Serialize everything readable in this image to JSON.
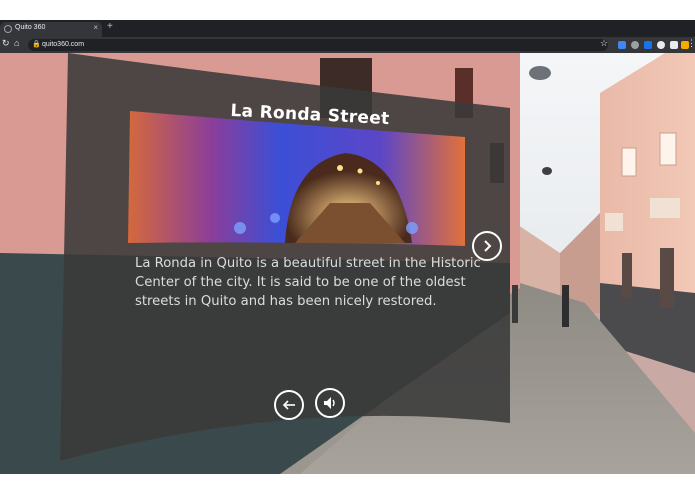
{
  "browser": {
    "tab_title": "Quito 360",
    "tab_close": "×",
    "new_tab": "+",
    "url": "quito360.com",
    "reload_icon": "reload-icon",
    "home_icon": "home-icon",
    "lock_icon": "lock-icon",
    "star_icon": "bookmark-star-icon",
    "menu_icon": "kebab-menu-icon",
    "extensions": [
      {
        "name": "extension-icon-1",
        "color": "#4285f4"
      },
      {
        "name": "extension-icon-2",
        "color": "#9aa0a6"
      },
      {
        "name": "extension-icon-3",
        "color": "#1a73e8"
      },
      {
        "name": "extension-icon-4",
        "color": "#e8eaed"
      },
      {
        "name": "extension-icon-5",
        "color": "#e8eaed"
      },
      {
        "name": "extension-icon-6",
        "color": "#f9ab00"
      }
    ]
  },
  "tour": {
    "title": "La Ronda Street",
    "description": "La Ronda in Quito is a beautiful street in the Historic Center of the city. It is said to be one of the oldest streets in Quito and has been nicely restored.",
    "next_icon": "chevron-right-icon",
    "back_icon": "arrow-left-icon",
    "sound_icon": "speaker-icon"
  },
  "colors": {
    "panel": "#3a3a3a",
    "panel_text": "#dcdcdc",
    "title": "#ffffff",
    "tunnel_blue": "#3b4fd6",
    "tunnel_orange": "#e2703a"
  }
}
